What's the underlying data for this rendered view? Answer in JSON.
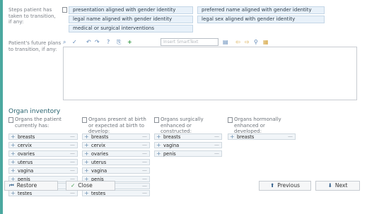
{
  "steps": {
    "label": "Steps patient has taken to transition, if any:",
    "options": [
      "presentation aligned with gender identity",
      "preferred name aligned with gender identity",
      "legal name aligned with gender identity",
      "legal sex aligned with gender identity",
      "medical or surgical interventions"
    ]
  },
  "future_plans": {
    "label": "Patient's future plans to transition, if any:",
    "search_placeholder": "Insert SmartText"
  },
  "organ_inventory": {
    "title": "Organ inventory",
    "columns": [
      {
        "header": "Organs the patient currently has:",
        "items": [
          "breasts",
          "cervix",
          "ovaries",
          "uterus",
          "vagina",
          "penis",
          "prostate",
          "testes"
        ]
      },
      {
        "header": "Organs present at birth or expected at birth to develop:",
        "items": [
          "breasts",
          "cervix",
          "ovaries",
          "uterus",
          "vagina",
          "penis",
          "prostate",
          "testes"
        ]
      },
      {
        "header": "Organs surgically enhanced or constructed:",
        "items": [
          "breasts",
          "vagina",
          "penis"
        ]
      },
      {
        "header": "Organs hormonally enhanced or developed:",
        "items": [
          "breasts"
        ]
      }
    ]
  },
  "footer": {
    "restore": "Restore",
    "close": "Close",
    "previous": "Previous",
    "next": "Next"
  },
  "colors": {
    "accent": "#4aa89f",
    "tag_bg": "#e8f1f9",
    "title": "#2a6470"
  }
}
